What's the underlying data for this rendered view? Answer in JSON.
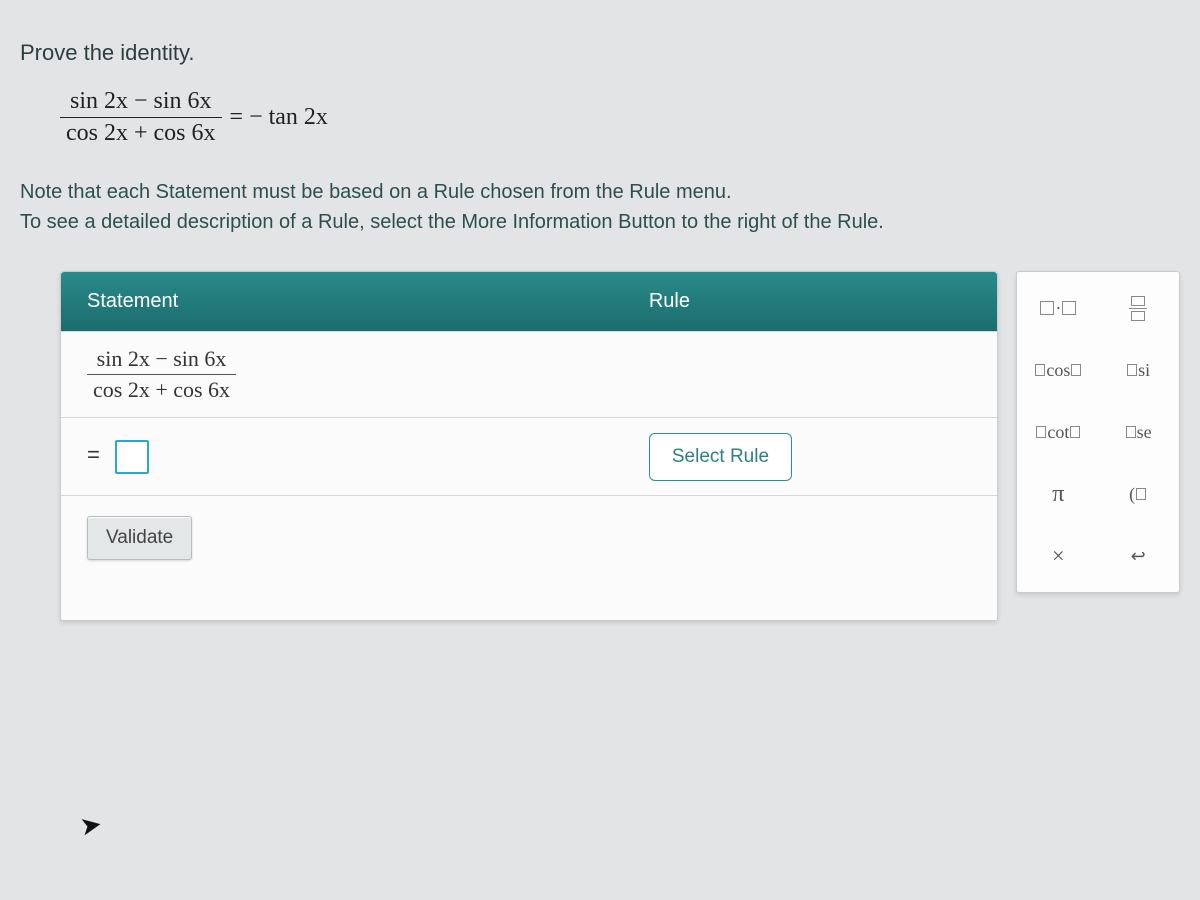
{
  "prompt": {
    "title": "Prove the identity.",
    "identity_numer": "sin 2x − sin 6x",
    "identity_denom": "cos 2x + cos 6x",
    "identity_rhs": "= − tan 2x",
    "note_line1": "Note that each Statement must be based on a Rule chosen from the Rule menu.",
    "note_line2": "To see a detailed description of a Rule, select the More Information Button to the right of the Rule."
  },
  "table": {
    "header_statement": "Statement",
    "header_rule": "Rule",
    "row1_numer": "sin 2x  −  sin 6x",
    "row1_denom": "cos 2x  +  cos 6x",
    "row2_eq": "=",
    "select_rule_label": "Select Rule",
    "validate_label": "Validate"
  },
  "toolbox": {
    "t1": "·",
    "t2_label": "frac",
    "t3": "cos",
    "t4": "si",
    "t5": "cot",
    "t6": "se",
    "t7": "π",
    "t8": "(",
    "t9": "×",
    "t10": "↩"
  }
}
